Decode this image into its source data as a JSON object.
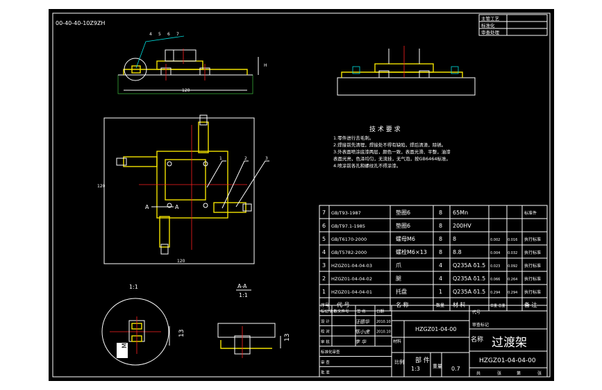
{
  "drawing": {
    "code_rotated": "00-40-40-10Z9ZH",
    "title": "过渡架",
    "code": "HZGZ01-04-04-00",
    "assembly_code": "HZGZ01-04-00",
    "section_name": "部  件",
    "scale": "1:3",
    "weight": "0.7",
    "scale_label": "比例",
    "weight_label": "重量",
    "name_label": "名称",
    "detail_scale": "1:1",
    "section_label": "A-A",
    "section_scale": "1:1",
    "section_mark_a": "A",
    "section_mark_b": "A",
    "dim_m6": "M6",
    "dim_13a": "13",
    "dim_13b": "13",
    "width_dim": "120",
    "height_dim": "120"
  },
  "approval_box": {
    "rows": [
      "主管工艺",
      "标准化",
      "审查处理"
    ]
  },
  "tech_requirements": {
    "title": "技 术 要 求",
    "items": [
      "1.零件进行去毛刺。",
      "2.焊接前先清理，焊接处不得有缺陷，焊后清渣，除锈。",
      "3.外表面喷涂底漆两层，颜色一致，表面光滑、平整，油漆",
      "  表面光亮，色泽均匀，无流挂，无气泡，按GB6464标准。",
      "4.喷涂前各孔和螺纹孔不得涂漆。"
    ]
  },
  "callouts": {
    "top_numbers": [
      "4",
      "5",
      "6",
      "7"
    ],
    "side_numbers": [
      "1",
      "2",
      "3"
    ]
  },
  "bom": {
    "header": {
      "no": "序号",
      "code": "代    号",
      "name": "名    称",
      "qty": "数量",
      "material": "材  料",
      "weight": "单重 总重",
      "remark": "备 注"
    },
    "rows": [
      {
        "no": "7",
        "code": "GB/T93-1987",
        "name": "垫圈6",
        "qty": "8",
        "material": "65Mn",
        "w1": "",
        "w2": "",
        "remark": "标准件"
      },
      {
        "no": "6",
        "code": "GB/T97.1-1985",
        "name": "垫圈6",
        "qty": "8",
        "material": "200HV",
        "w1": "",
        "w2": "",
        "remark": ""
      },
      {
        "no": "5",
        "code": "GB/T6170-2000",
        "name": "螺母M6",
        "qty": "8",
        "material": "8",
        "w1": "0.002",
        "w2": "0.016",
        "remark": "执行标准"
      },
      {
        "no": "4",
        "code": "GB/T5782-2000",
        "name": "螺栓M6×13",
        "qty": "8",
        "material": "8.8",
        "w1": "0.004",
        "w2": "0.032",
        "remark": "执行标准"
      },
      {
        "no": "3",
        "code": "HZGZ01-04-04-03",
        "name": "爪",
        "qty": "4",
        "material": "Q235A δ1.5",
        "w1": "0.023",
        "w2": "0.092",
        "remark": "执行标准"
      },
      {
        "no": "2",
        "code": "HZGZ01-04-04-02",
        "name": "腿",
        "qty": "4",
        "material": "Q235A δ1.5",
        "w1": "0.066",
        "w2": "0.264",
        "remark": "执行标准"
      },
      {
        "no": "1",
        "code": "HZGZ01-04-04-01",
        "name": "托盘",
        "qty": "1",
        "material": "Q235A δ1.5",
        "w1": "0.294",
        "w2": "0.294",
        "remark": "执行标准"
      }
    ]
  },
  "title_block": {
    "left_rows": [
      "标记 处数",
      "设  计",
      "校  对",
      "审  核",
      "标准化审查",
      "审  查",
      "批  准"
    ],
    "signatures": [
      "汪德华",
      "陈小虎",
      "李 华"
    ],
    "dates": [
      "2010.10",
      "2010.10"
    ],
    "left_header": [
      "文件号",
      "签 名",
      "日期"
    ],
    "sheet_labels": [
      "共",
      "张",
      "第",
      "张"
    ],
    "material_label": "材料",
    "label_code": "代号",
    "label_approved": "审查标记"
  },
  "colors": {
    "background": "#000000",
    "frame": "#ffffff",
    "part": "#f2e200",
    "centerline": "#ff2020",
    "hidden": "#00e0e0",
    "outside": "#ffffff"
  }
}
